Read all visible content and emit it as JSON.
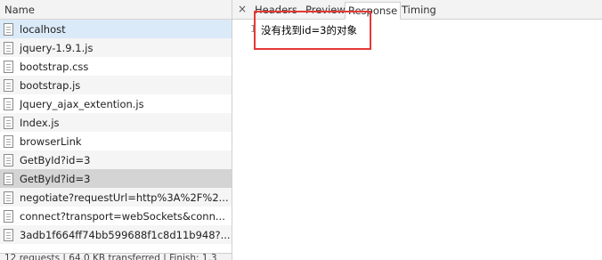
{
  "network": {
    "column_header": "Name",
    "requests": [
      "localhost",
      "jquery-1.9.1.js",
      "bootstrap.css",
      "bootstrap.js",
      "Jquery_ajax_extention.js",
      "Index.js",
      "browserLink",
      "GetById?id=3",
      "GetById?id=3",
      "negotiate?requestUrl=http%3A%2F%2...",
      "connect?transport=webSockets&conn...",
      "3adb1f664ff74bb599688f1c8d11b948?..."
    ],
    "status_text": "12 requests  |  64.0 KB transferred  |  Finish: 1.3"
  },
  "detail": {
    "close_glyph": "×",
    "tabs": [
      "Headers",
      "Preview",
      "Response",
      "Timing"
    ],
    "active_tab": "Response",
    "line_number": "1",
    "response_text": "没有找到id=3的对象"
  },
  "colors": {
    "highlight": "#e53935",
    "selected_row": "#d4d4d4",
    "first_row": "#dbeaf8"
  }
}
